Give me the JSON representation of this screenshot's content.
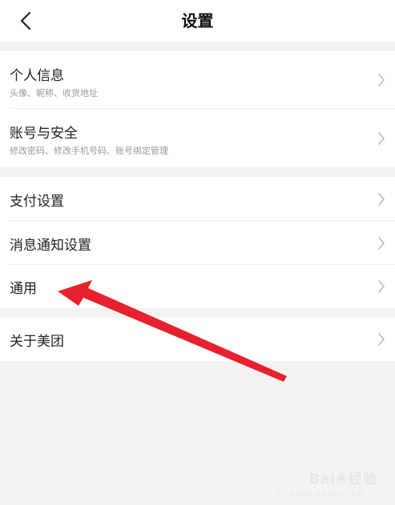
{
  "header": {
    "title": "设置",
    "back_icon": "chevron-left-icon"
  },
  "groups": [
    {
      "items": [
        {
          "label": "个人信息",
          "sublabel": "头像、昵称、收货地址"
        },
        {
          "label": "账号与安全",
          "sublabel": "修改密码、修改手机号码、账号绑定管理"
        }
      ]
    },
    {
      "items": [
        {
          "label": "支付设置"
        },
        {
          "label": "消息通知设置"
        },
        {
          "label": "通用"
        }
      ]
    },
    {
      "items": [
        {
          "label": "关于美团"
        }
      ]
    }
  ],
  "annotation": {
    "type": "arrow",
    "color": "#e8212e",
    "points_to": "通用"
  },
  "watermark": {
    "brand_part1": "Bai",
    "brand_part2": "经验",
    "sub": "jingyan.baidu.com"
  },
  "colors": {
    "background": "#f3f3f3",
    "surface": "#ffffff",
    "text": "#222222",
    "subtext": "#999999",
    "chevron": "#bbbbbb"
  }
}
